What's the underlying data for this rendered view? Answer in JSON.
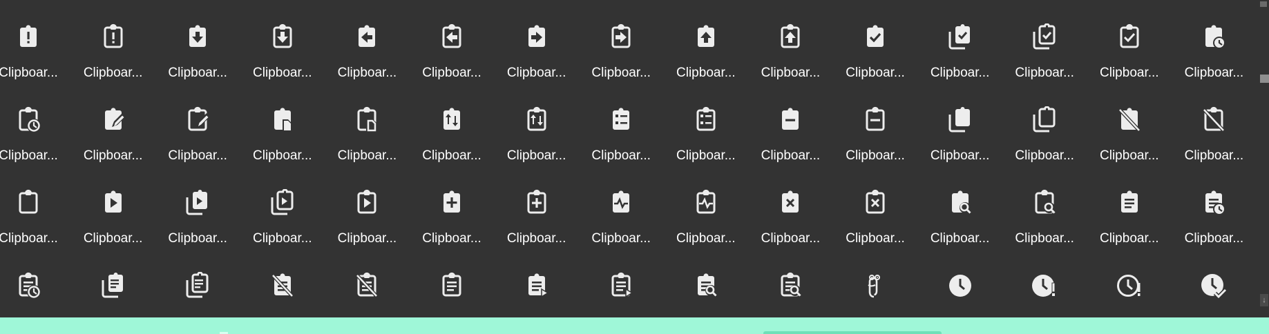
{
  "icon_color": "#ededed",
  "background": "#333333",
  "footer_color": "#9ff7d8",
  "scrollbar": {
    "down_arrow": "↓"
  },
  "items": [
    {
      "label": "Clipboar...",
      "icon": "clipboard-alert-icon"
    },
    {
      "label": "Clipboar...",
      "icon": "clipboard-alert-outline-icon"
    },
    {
      "label": "Clipboar...",
      "icon": "clipboard-arrow-down-icon"
    },
    {
      "label": "Clipboar...",
      "icon": "clipboard-arrow-down-outline-icon"
    },
    {
      "label": "Clipboar...",
      "icon": "clipboard-arrow-left-icon"
    },
    {
      "label": "Clipboar...",
      "icon": "clipboard-arrow-left-outline-icon"
    },
    {
      "label": "Clipboar...",
      "icon": "clipboard-arrow-right-icon"
    },
    {
      "label": "Clipboar...",
      "icon": "clipboard-arrow-right-outline-icon"
    },
    {
      "label": "Clipboar...",
      "icon": "clipboard-arrow-up-icon"
    },
    {
      "label": "Clipboar...",
      "icon": "clipboard-arrow-up-outline-icon"
    },
    {
      "label": "Clipboar...",
      "icon": "clipboard-check-icon"
    },
    {
      "label": "Clipboar...",
      "icon": "clipboard-check-multiple-icon"
    },
    {
      "label": "Clipboar...",
      "icon": "clipboard-check-multiple-outline-icon"
    },
    {
      "label": "Clipboar...",
      "icon": "clipboard-check-outline-icon"
    },
    {
      "label": "Clipboar...",
      "icon": "clipboard-clock-icon"
    },
    {
      "label": "Clipboar...",
      "icon": "clipboard-clock-outline-icon"
    },
    {
      "label": "Clipboar...",
      "icon": "clipboard-edit-icon"
    },
    {
      "label": "Clipboar...",
      "icon": "clipboard-edit-outline-icon"
    },
    {
      "label": "Clipboar...",
      "icon": "clipboard-file-icon"
    },
    {
      "label": "Clipboar...",
      "icon": "clipboard-file-outline-icon"
    },
    {
      "label": "Clipboar...",
      "icon": "clipboard-flow-icon"
    },
    {
      "label": "Clipboar...",
      "icon": "clipboard-flow-outline-icon"
    },
    {
      "label": "Clipboar...",
      "icon": "clipboard-list-icon"
    },
    {
      "label": "Clipboar...",
      "icon": "clipboard-list-outline-icon"
    },
    {
      "label": "Clipboar...",
      "icon": "clipboard-minus-icon"
    },
    {
      "label": "Clipboar...",
      "icon": "clipboard-minus-outline-icon"
    },
    {
      "label": "Clipboar...",
      "icon": "clipboard-multiple-icon"
    },
    {
      "label": "Clipboar...",
      "icon": "clipboard-multiple-outline-icon"
    },
    {
      "label": "Clipboar...",
      "icon": "clipboard-off-icon"
    },
    {
      "label": "Clipboar...",
      "icon": "clipboard-off-outline-icon"
    },
    {
      "label": "Clipboar...",
      "icon": "clipboard-outline-icon"
    },
    {
      "label": "Clipboar...",
      "icon": "clipboard-play-icon"
    },
    {
      "label": "Clipboar...",
      "icon": "clipboard-play-multiple-icon"
    },
    {
      "label": "Clipboar...",
      "icon": "clipboard-play-multiple-outline-icon"
    },
    {
      "label": "Clipboar...",
      "icon": "clipboard-play-outline-icon"
    },
    {
      "label": "Clipboar...",
      "icon": "clipboard-plus-icon"
    },
    {
      "label": "Clipboar...",
      "icon": "clipboard-plus-outline-icon"
    },
    {
      "label": "Clipboar...",
      "icon": "clipboard-pulse-icon"
    },
    {
      "label": "Clipboar...",
      "icon": "clipboard-pulse-outline-icon"
    },
    {
      "label": "Clipboar...",
      "icon": "clipboard-remove-icon"
    },
    {
      "label": "Clipboar...",
      "icon": "clipboard-remove-outline-icon"
    },
    {
      "label": "Clipboar...",
      "icon": "clipboard-search-icon"
    },
    {
      "label": "Clipboar...",
      "icon": "clipboard-search-outline-icon"
    },
    {
      "label": "Clipboar...",
      "icon": "clipboard-text-icon"
    },
    {
      "label": "Clipboar...",
      "icon": "clipboard-text-clock-icon"
    },
    {
      "label": "",
      "icon": "clipboard-text-clock-outline-icon"
    },
    {
      "label": "",
      "icon": "clipboard-text-multiple-icon"
    },
    {
      "label": "",
      "icon": "clipboard-text-multiple-outline-icon"
    },
    {
      "label": "",
      "icon": "clipboard-text-off-icon"
    },
    {
      "label": "",
      "icon": "clipboard-text-off-outline-icon"
    },
    {
      "label": "",
      "icon": "clipboard-text-outline-icon"
    },
    {
      "label": "",
      "icon": "clipboard-text-play-icon"
    },
    {
      "label": "",
      "icon": "clipboard-text-play-outline-icon"
    },
    {
      "label": "",
      "icon": "clipboard-text-search-icon"
    },
    {
      "label": "",
      "icon": "clipboard-text-search-outline-icon"
    },
    {
      "label": "",
      "icon": "clippy-icon"
    },
    {
      "label": "",
      "icon": "clock-icon"
    },
    {
      "label": "",
      "icon": "clock-alert-icon"
    },
    {
      "label": "",
      "icon": "clock-alert-outline-icon"
    },
    {
      "label": "",
      "icon": "clock-check-icon"
    }
  ]
}
